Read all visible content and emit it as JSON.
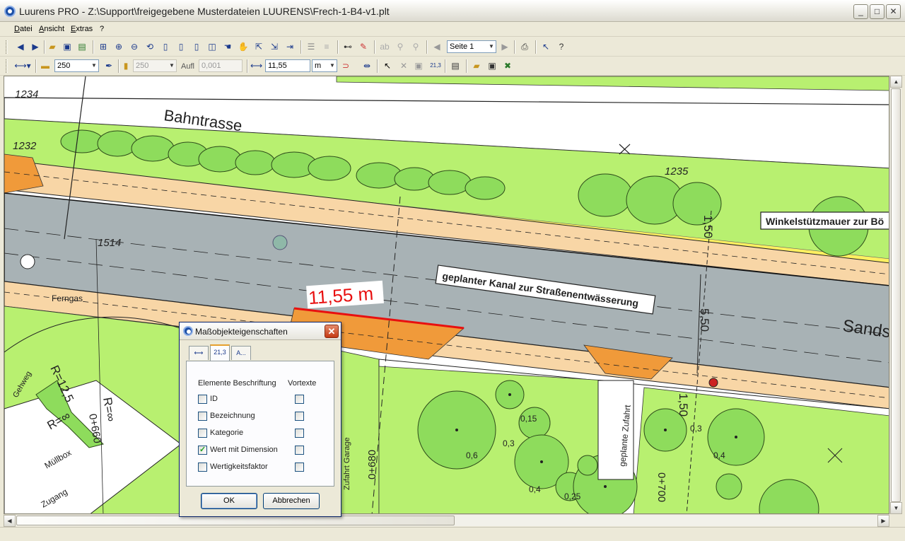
{
  "window": {
    "title": "Luurens PRO - Z:\\Support\\freigegebene Musterdateien LUURENS\\Frech-1-B4-v1.plt",
    "minimize": "_",
    "maximize": "□",
    "close": "✕"
  },
  "menu": {
    "items": [
      {
        "label": "Datei"
      },
      {
        "label": "Ansicht"
      },
      {
        "label": "Extras"
      },
      {
        "label": "?"
      }
    ]
  },
  "toolbar1": {
    "page_select": "Seite 1"
  },
  "toolbar2": {
    "line_width": "250",
    "line_width2": "250",
    "resolution_label": "Aufl",
    "resolution_value": "0,001",
    "measure_value": "11,55",
    "measure_unit": "m"
  },
  "map": {
    "labels": {
      "bahntrasse": "Bahntrasse",
      "parcel_1234": "1234",
      "parcel_1232": "1232",
      "parcel_1235": "1235",
      "parcel_1514": "1514",
      "ferngas": "Ferngas",
      "gehweg": "Gehweg",
      "muellbox": "Müllbox",
      "zugang": "Zugang",
      "zufahrt_garage": "Zufahrt Garage",
      "station_1": "0+680",
      "station_2": "0+660",
      "station_3": "0+700",
      "radius_1": "R=12,5",
      "radius_2": "R=∞",
      "radius_3": "R=∞",
      "geplante_zufahrt": "geplante Zufahrt",
      "kanal": "geplanter Kanal zur Straßenentwässerung",
      "winkelstuetzmauer": "Winkelstützmauer zur Bö",
      "sandstr": "Sands",
      "dim_150_top": "1,50",
      "dim_550": "5,50",
      "dim_150_bottom": "1,50",
      "tree_06": "0,6",
      "tree_015": "0,15",
      "tree_03a": "0,3",
      "tree_04a": "0,4",
      "tree_025": "0,25",
      "tree_03b": "0,3",
      "tree_04b": "0,4"
    },
    "measurement": "11,55 m"
  },
  "dialog": {
    "title": "Maßobjekteigenschaften",
    "tabs": [
      {
        "icon": "dimension-line-icon",
        "label": "⟷"
      },
      {
        "icon": "value-icon",
        "label": "21,3"
      },
      {
        "icon": "text-icon",
        "label": "A..."
      }
    ],
    "col_elements": "Elemente Beschriftung",
    "col_pretext": "Vortexte",
    "rows": [
      {
        "label": "ID",
        "checked": false,
        "pretext": false
      },
      {
        "label": "Bezeichnung",
        "checked": false,
        "pretext": false
      },
      {
        "label": "Kategorie",
        "checked": false,
        "pretext": false
      },
      {
        "label": "Wert mit Dimension",
        "checked": true,
        "pretext": false
      },
      {
        "label": "Wertigkeitsfaktor",
        "checked": false,
        "pretext": false
      }
    ],
    "ok": "OK",
    "cancel": "Abbrechen"
  },
  "colors": {
    "road": "#a8b2b5",
    "sidewalk": "#f8d6a6",
    "grass": "#b8f070",
    "tree": "#8edc5c",
    "orange": "#f09a3a",
    "measure_red": "#e81010"
  }
}
